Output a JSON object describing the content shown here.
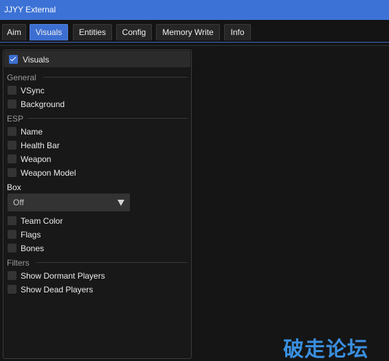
{
  "window": {
    "title": "JJYY External"
  },
  "tabs": [
    {
      "label": "Aim",
      "active": false
    },
    {
      "label": "Visuals",
      "active": true
    },
    {
      "label": "Entities",
      "active": false
    },
    {
      "label": "Config",
      "active": false
    },
    {
      "label": "Memory Write",
      "active": false
    },
    {
      "label": "Info",
      "active": false
    }
  ],
  "visuals": {
    "header": {
      "label": "Visuals",
      "checked": true
    },
    "general": {
      "title": "General",
      "items": [
        {
          "label": "VSync",
          "checked": false
        },
        {
          "label": "Background",
          "checked": false
        }
      ]
    },
    "esp": {
      "title": "ESP",
      "items": [
        {
          "label": "Name",
          "checked": false
        },
        {
          "label": "Health Bar",
          "checked": false
        },
        {
          "label": "Weapon",
          "checked": false
        },
        {
          "label": "Weapon Model",
          "checked": false
        }
      ],
      "box": {
        "label": "Box",
        "value": "Off"
      },
      "items_after_box": [
        {
          "label": "Team Color",
          "checked": false
        },
        {
          "label": "Flags",
          "checked": false
        },
        {
          "label": "Bones",
          "checked": false
        }
      ]
    },
    "filters": {
      "title": "Filters",
      "items": [
        {
          "label": "Show Dormant Players",
          "checked": false
        },
        {
          "label": "Show Dead Players",
          "checked": false
        }
      ]
    }
  },
  "watermark": {
    "text": "破走论坛"
  },
  "colors": {
    "accent": "#3d6fd2",
    "titlebar": "#3c72d6",
    "background": "#151515",
    "panel": "#181818",
    "frame": "#343434",
    "watermark": "#3a8fe0"
  },
  "icons": {
    "checkmark": "check-icon",
    "combo_arrow": "triangle-down-icon"
  }
}
